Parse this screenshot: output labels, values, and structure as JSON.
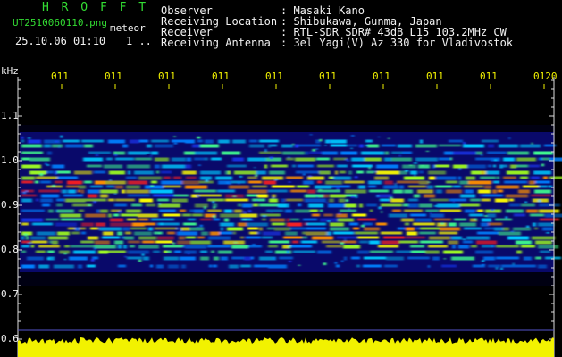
{
  "header": {
    "app_name": "H R O F F T",
    "filename": "UT2510060110.png",
    "tag": "meteor",
    "timestamp": "25.10.06 01:10",
    "page_marker": "1 .."
  },
  "station": {
    "labels": [
      "Observer",
      "Receiving Location",
      "Receiver",
      "Receiving Antenna"
    ],
    "values": [
      ": Masaki Kano",
      ": Shibukawa, Gunma, Japan",
      ": RTL-SDR SDR# 43dB L15 103.2MHz CW",
      ": 3el Yagi(V) Az 330 for Vladivostok"
    ]
  },
  "axes": {
    "y_unit": "kHz",
    "y_ticks": [
      "1.1",
      "1.0",
      "0.9",
      "0.8",
      "0.7",
      "0.6"
    ],
    "x_ticks": [
      "011",
      "011",
      "011",
      "011",
      "011",
      "011",
      "011",
      "011",
      "011",
      "0120"
    ]
  },
  "colors": {
    "background": "#000000",
    "header_title": "#33dd33",
    "text": "#f2f2f2",
    "time_labels": "#f2f200",
    "level_bar": "#f2f200",
    "spectrogram_base": "#0a0a8a"
  }
}
